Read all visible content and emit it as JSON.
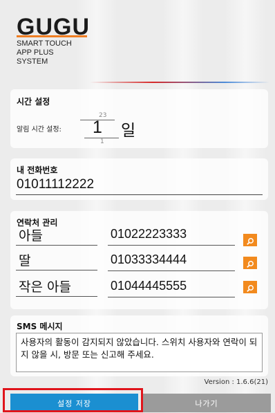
{
  "app": {
    "logo": "GUGU",
    "tagline": "SMART TOUCH\nAPP PLUS\nSYSTEM",
    "accent_color": "#ef7d22"
  },
  "time_setting": {
    "title": "시간 설정",
    "alarm_label": "알림 시간 설정:",
    "picker_prev": "23",
    "picker_value": "1",
    "picker_next": "1",
    "picker_unit": "일"
  },
  "my_phone": {
    "title": "내 전화번호",
    "value": "01011112222"
  },
  "contacts": {
    "title": "연락처 관리",
    "search_icon": "search-icon",
    "items": [
      {
        "name": "아들",
        "number": "01022223333"
      },
      {
        "name": "딸",
        "number": "01033334444"
      },
      {
        "name": "작은 아들",
        "number": "01044445555"
      }
    ]
  },
  "sms": {
    "title": "SMS 메시지",
    "message": "사용자의 활동이 감지되지 않았습니다. 스위치 사용자와 연락이 되지 않을 시, 방문 또는 신고해 주세요."
  },
  "version": "Version : 1.6.6(21)",
  "buttons": {
    "save": "설정 저장",
    "exit": "나가기",
    "save_color": "#1b8fd1",
    "exit_color": "#9b9b9b",
    "highlight_color": "#e0141b"
  }
}
